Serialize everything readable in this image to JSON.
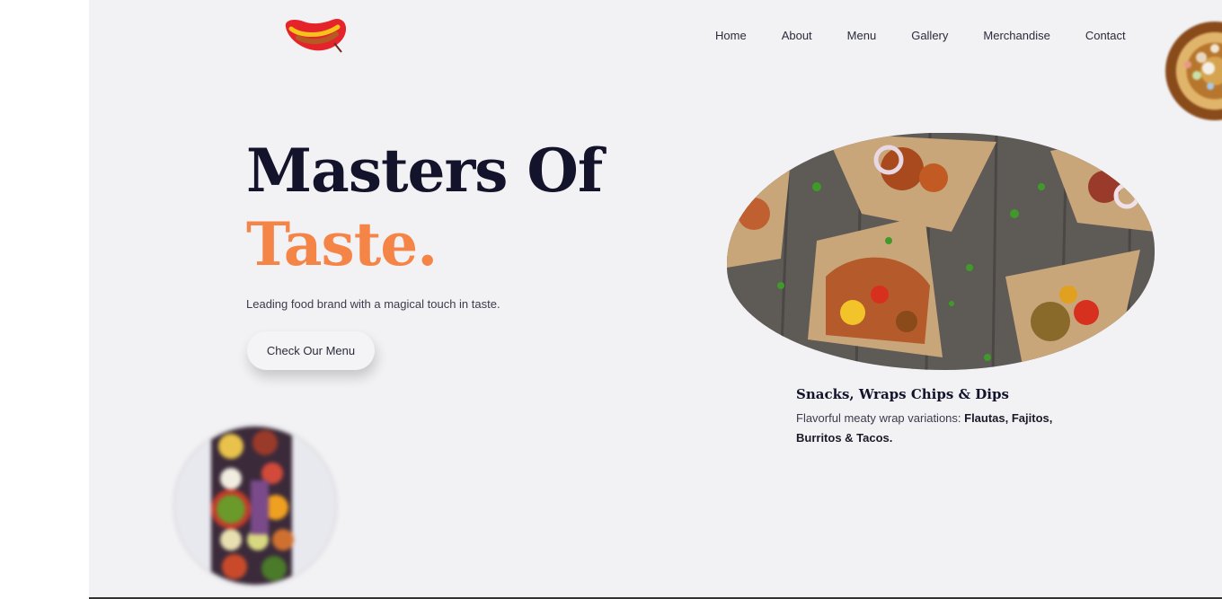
{
  "brand": {
    "logo_icon": "hotdog-logo-icon"
  },
  "nav": {
    "items": [
      {
        "label": "Home"
      },
      {
        "label": "About"
      },
      {
        "label": "Menu"
      },
      {
        "label": "Gallery"
      },
      {
        "label": "Merchandise"
      },
      {
        "label": "Contact"
      }
    ]
  },
  "hero": {
    "title_line1": "Masters Of",
    "title_line2": "Taste.",
    "subtitle": "Leading food brand with a magical touch in taste.",
    "cta_label": "Check Our Menu"
  },
  "feature": {
    "title": "Snacks, Wraps Chips & Dips",
    "desc_prefix": "Flavorful meaty wrap variations: ",
    "desc_bold_1": "Flautas, Fajitos,",
    "desc_bold_2": "Burritos & Tacos."
  },
  "colors": {
    "accent": "#f58447",
    "heading": "#13132b",
    "background": "#f2f2f5"
  }
}
